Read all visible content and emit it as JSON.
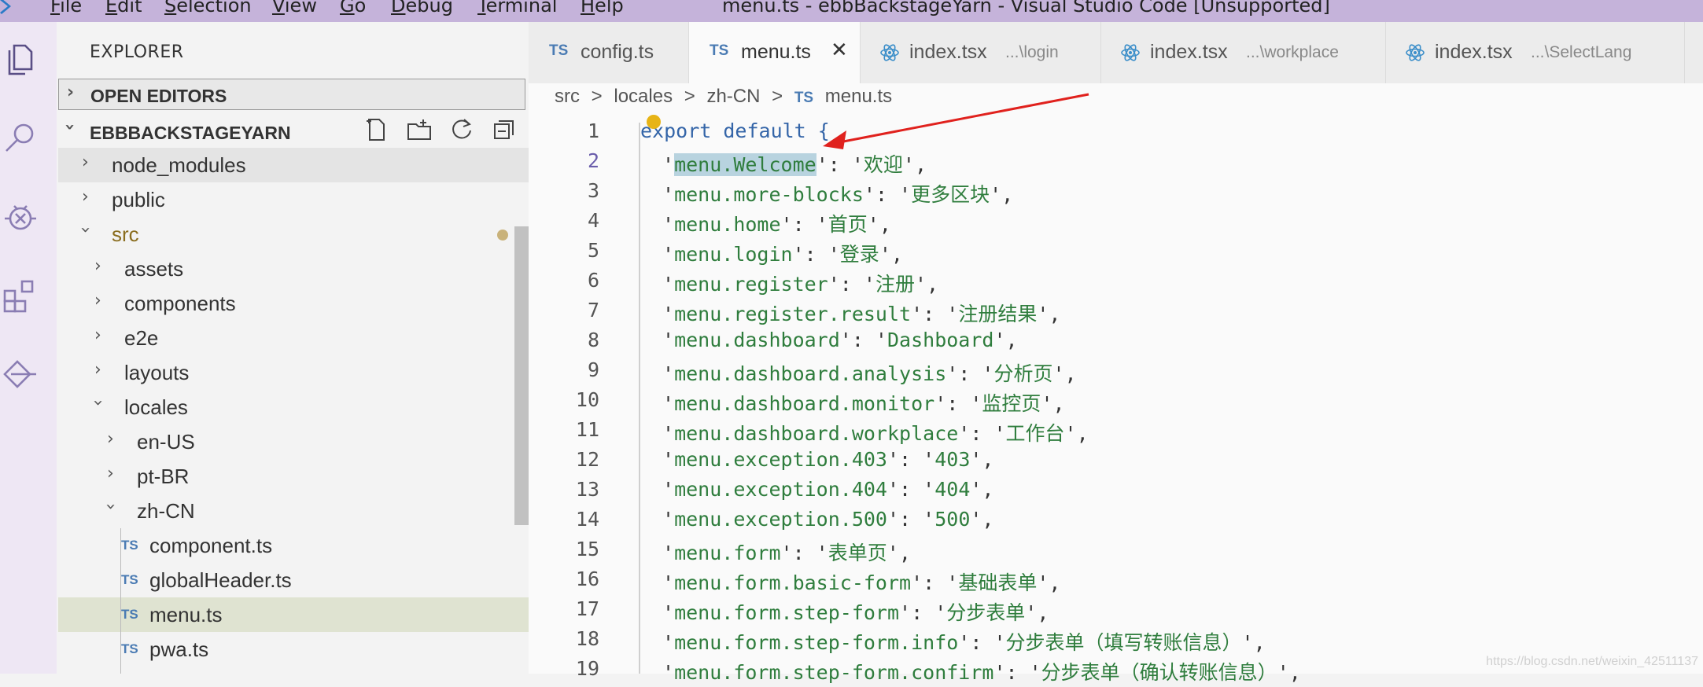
{
  "titlebar": {
    "menus": [
      "File",
      "Edit",
      "Selection",
      "View",
      "Go",
      "Debug",
      "Terminal",
      "Help"
    ],
    "title": "menu.ts - ebbBackstageYarn - Visual Studio Code [Unsupported]"
  },
  "sidebar": {
    "title": "EXPLORER",
    "open_editors": "OPEN EDITORS",
    "project": "EBBBACKSTAGEYARN",
    "tree": [
      {
        "label": "node_modules",
        "type": "folder",
        "depth": 0,
        "expanded": false
      },
      {
        "label": "public",
        "type": "folder",
        "depth": 0,
        "expanded": false
      },
      {
        "label": "src",
        "type": "folder",
        "depth": 0,
        "expanded": true,
        "modified": true
      },
      {
        "label": "assets",
        "type": "folder",
        "depth": 1,
        "expanded": false
      },
      {
        "label": "components",
        "type": "folder",
        "depth": 1,
        "expanded": false
      },
      {
        "label": "e2e",
        "type": "folder",
        "depth": 1,
        "expanded": false
      },
      {
        "label": "layouts",
        "type": "folder",
        "depth": 1,
        "expanded": false
      },
      {
        "label": "locales",
        "type": "folder",
        "depth": 1,
        "expanded": true
      },
      {
        "label": "en-US",
        "type": "folder",
        "depth": 2,
        "expanded": false
      },
      {
        "label": "pt-BR",
        "type": "folder",
        "depth": 2,
        "expanded": false
      },
      {
        "label": "zh-CN",
        "type": "folder",
        "depth": 2,
        "expanded": true
      },
      {
        "label": "component.ts",
        "type": "ts",
        "depth": 3
      },
      {
        "label": "globalHeader.ts",
        "type": "ts",
        "depth": 3
      },
      {
        "label": "menu.ts",
        "type": "ts",
        "depth": 3,
        "selected": true
      },
      {
        "label": "pwa.ts",
        "type": "ts",
        "depth": 3
      }
    ]
  },
  "tabs": [
    {
      "label": "config.ts",
      "icon": "TS",
      "desc": ""
    },
    {
      "label": "menu.ts",
      "icon": "TS",
      "desc": "",
      "active": true
    },
    {
      "label": "index.tsx",
      "icon": "react",
      "desc": "...\\login"
    },
    {
      "label": "index.tsx",
      "icon": "react",
      "desc": "...\\workplace"
    },
    {
      "label": "index.tsx",
      "icon": "react",
      "desc": "...\\SelectLang"
    }
  ],
  "breadcrumb": {
    "parts": [
      "src",
      "locales",
      "zh-CN"
    ],
    "file": "menu.ts",
    "file_icon": "TS",
    "sep": ">"
  },
  "editor": {
    "lines": [
      {
        "n": "1",
        "key": "",
        "val": "",
        "head": "export default {"
      },
      {
        "n": "2",
        "key": "menu.Welcome",
        "val": "欢迎"
      },
      {
        "n": "3",
        "key": "menu.more-blocks",
        "val": "更多区块"
      },
      {
        "n": "4",
        "key": "menu.home",
        "val": "首页"
      },
      {
        "n": "5",
        "key": "menu.login",
        "val": "登录"
      },
      {
        "n": "6",
        "key": "menu.register",
        "val": "注册"
      },
      {
        "n": "7",
        "key": "menu.register.result",
        "val": "注册结果"
      },
      {
        "n": "8",
        "key": "menu.dashboard",
        "val": "Dashboard"
      },
      {
        "n": "9",
        "key": "menu.dashboard.analysis",
        "val": "分析页"
      },
      {
        "n": "10",
        "key": "menu.dashboard.monitor",
        "val": "监控页"
      },
      {
        "n": "11",
        "key": "menu.dashboard.workplace",
        "val": "工作台"
      },
      {
        "n": "12",
        "key": "menu.exception.403",
        "val": "403"
      },
      {
        "n": "13",
        "key": "menu.exception.404",
        "val": "404"
      },
      {
        "n": "14",
        "key": "menu.exception.500",
        "val": "500"
      },
      {
        "n": "15",
        "key": "menu.form",
        "val": "表单页"
      },
      {
        "n": "16",
        "key": "menu.form.basic-form",
        "val": "基础表单"
      },
      {
        "n": "17",
        "key": "menu.form.step-form",
        "val": "分步表单"
      },
      {
        "n": "18",
        "key": "menu.form.step-form.info",
        "val": "分步表单（填写转账信息）"
      },
      {
        "n": "19",
        "key": "menu.form.step-form.confirm",
        "val": "分步表单（确认转账信息）"
      }
    ]
  },
  "watermark": "https://blog.csdn.net/weixin_42511137",
  "colors": {
    "titlebar": "#c5b3da",
    "activity": "#eee7f4",
    "arrow": "#e0211d",
    "string": "#2f7d3d",
    "keyword": "#3465a8"
  }
}
